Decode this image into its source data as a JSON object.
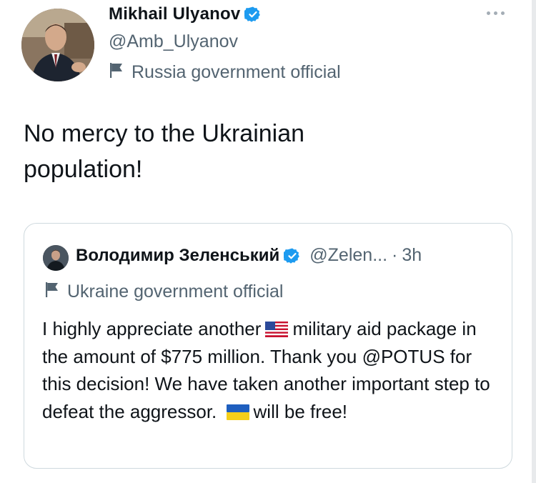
{
  "tweet": {
    "author_name": "Mikhail Ulyanov",
    "author_handle": "@Amb_Ulyanov",
    "author_label": "Russia government official",
    "text_line1": "No mercy to the Ukrainian",
    "text_line2": "population!"
  },
  "quoted_tweet": {
    "author_name": "Володимир Зеленський",
    "author_handle": "@Zelen...",
    "separator": "·",
    "time": "3h",
    "author_label": "Ukraine government official",
    "text_part1": "I highly appreciate another",
    "text_part2": "military aid package in the amount of $775 million. Thank you @POTUS for this decision! We have taken another important step to defeat the aggressor.",
    "text_part3": "will be free!"
  },
  "icons": {
    "verified": "verified-badge-icon",
    "flag": "government-flag-icon",
    "more": "more-options-icon",
    "us_flag": "us-flag-emoji",
    "ukraine_flag": "ukraine-flag-emoji"
  },
  "colors": {
    "verified_blue": "#1d9bf0",
    "secondary_text": "#536471",
    "border": "#cfd9de"
  }
}
